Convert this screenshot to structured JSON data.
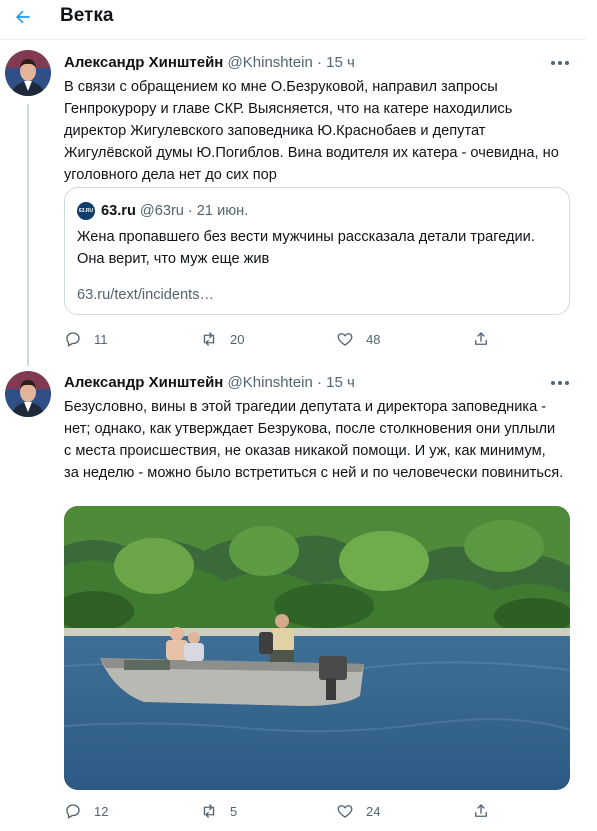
{
  "header": {
    "back_icon": "arrow-left-icon",
    "title": "Ветка"
  },
  "colors": {
    "accent": "#1d9bf0",
    "text": "#0f1419",
    "muted": "#536471",
    "border": "#cfd9de"
  },
  "tweets": [
    {
      "author": "Александр Хинштейн",
      "handle": "@Khinshtein",
      "sep": "·",
      "time": "15 ч",
      "text": "В связи с обращением ко мне О.Безруковой, направил запросы Генпрокурору и главе СКР. Выясняется, что на катере находились директор Жигулевского заповедника Ю.Краснобаев и депутат Жигулёвской думы Ю.Погиблов.  Вина водителя их катера - очевидна, но уголовного дела нет до сих пор",
      "quote": {
        "logo_text": "63.RU",
        "name": "63.ru",
        "handle": "@63ru",
        "sep": "·",
        "date": "21 июн.",
        "text": "Жена пропавшего без вести мужчины рассказала детали трагедии. Она верит, что муж еще жив",
        "link": "63.ru/text/incidents…"
      },
      "replies": "11",
      "retweets": "20",
      "likes": "48"
    },
    {
      "author": "Александр Хинштейн",
      "handle": "@Khinshtein",
      "sep": "·",
      "time": "15 ч",
      "text": "Безусловно, вины в этой трагедии депутата и директора заповедника - нет; однако, как утверждает Безрукова, после столкновения они уплыли с места происшествия, не оказав никакой помощи. И уж, как минимум, за неделю - можно было встретиться с ней и по человечески повиниться.",
      "replies": "12",
      "retweets": "5",
      "likes": "24"
    }
  ]
}
